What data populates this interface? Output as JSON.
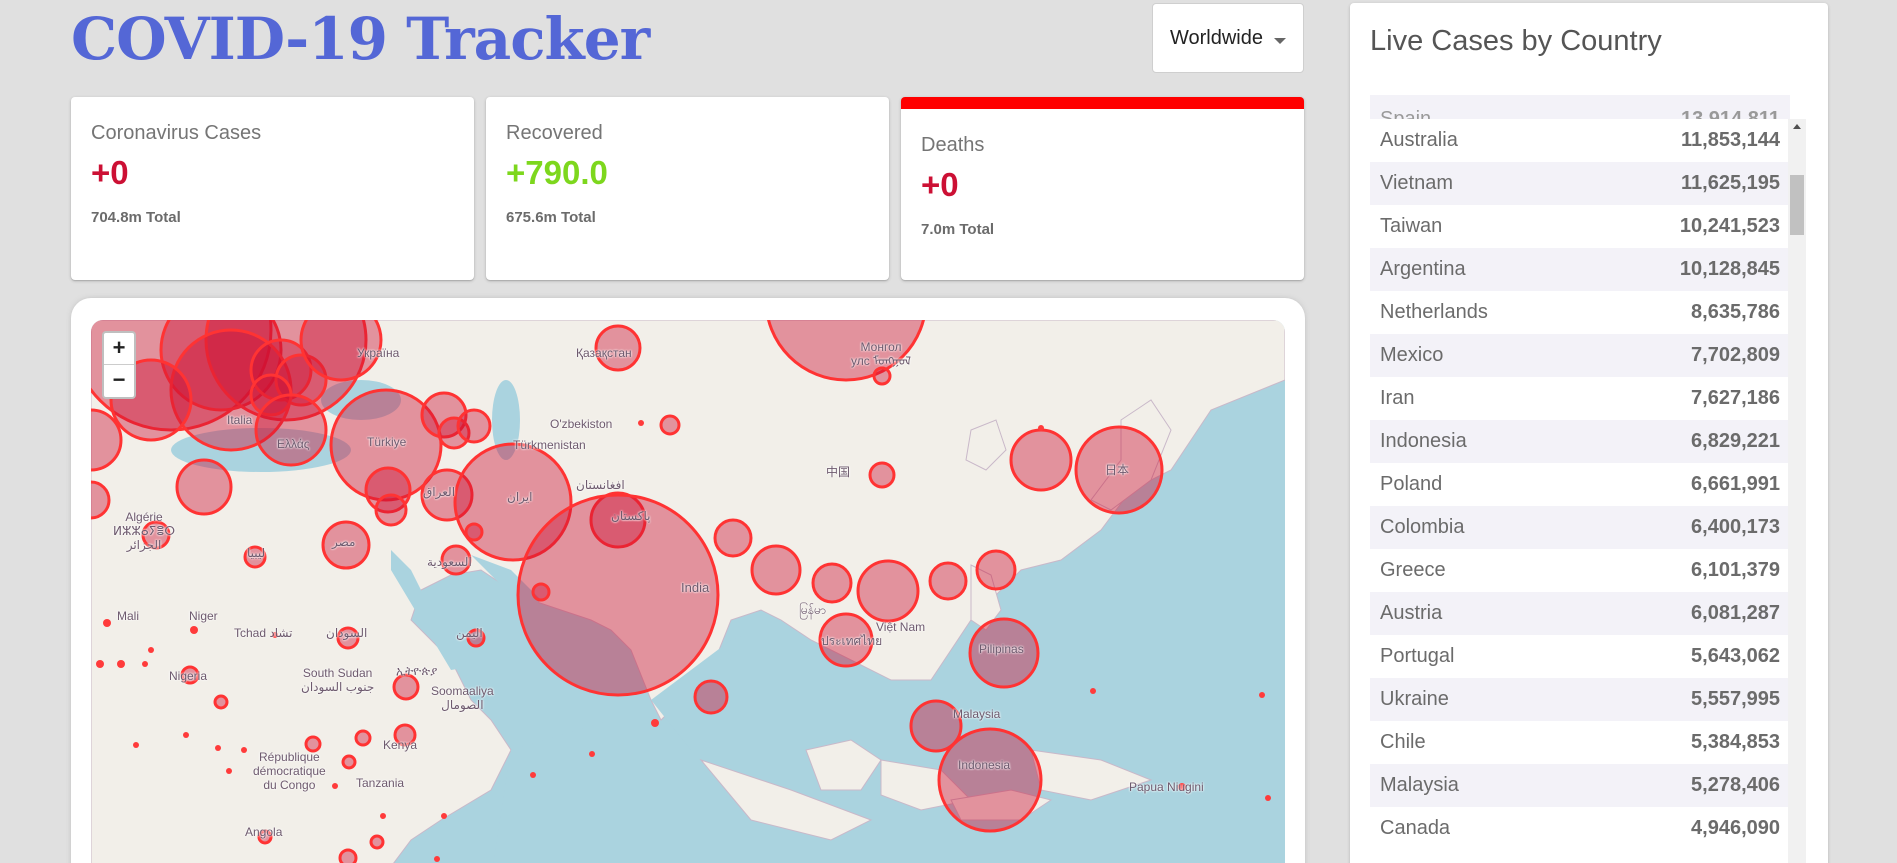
{
  "header": {
    "title": "COVID-19 Tracker",
    "country_select": {
      "value": "Worldwide"
    }
  },
  "stats": [
    {
      "label": "Coronavirus Cases",
      "value": "+0",
      "total": "704.8m Total",
      "active": false
    },
    {
      "label": "Recovered",
      "value": "+790.0",
      "total": "675.6m Total",
      "active": false
    },
    {
      "label": "Deaths",
      "value": "+0",
      "total": "7.0m Total",
      "active": true
    }
  ],
  "map": {
    "zoom_in": "+",
    "zoom_out": "−",
    "labels": {
      "kazakhstan": "Қазақстан",
      "mongolia": "Монгол\nулс ᠮᠣᠩᠭᠣᠯ",
      "ukraine": "Україна",
      "uzbekistan": "O'zbekiston",
      "turkmenistan": "Türkmenistan",
      "turkiye": "Türkiye",
      "italia": "Italia",
      "ellas": "Ελλάς",
      "china": "中国",
      "japan": "日本",
      "iraq": "العراق",
      "iran": "ایران",
      "afghanistan": "افغانستان",
      "pakistan": "پاکستان",
      "algeria": "Algérie\nⵍⵣⵣⴰⵢⴻⵔ\nالجزائر",
      "libya": "ليبيا",
      "egypt": "مصر",
      "saudi": "السعودية",
      "india": "India",
      "myanmar": "မြန်မာ",
      "vietnam": "Việt Nam",
      "thailand": "ประเทศไทย",
      "philippines": "Pilipinas",
      "malaysia": "Malaysia",
      "indonesia": "Indonesia",
      "papua": "Papua Niugini",
      "mali": "Mali",
      "niger": "Niger",
      "chad": "Tchad تشاد",
      "sudan": "السودان",
      "yemen": "اليمن",
      "nigeria": "Nigeria",
      "south_sudan": "South Sudan\nجنوب السودان",
      "ethiopia": "ኢትዮጵያ",
      "somalia": "Soomaaliya\nالصومال",
      "kenya": "Kenya",
      "drc": "République\ndémocratique\ndu Congo",
      "tanzania": "Tanzania",
      "angola": "Angola"
    },
    "circle_color": "#cc1034"
  },
  "live_cases": {
    "title": "Live Cases by Country",
    "clipped_row": {
      "country": "Spain",
      "cases": "13,914,811"
    },
    "rows": [
      {
        "country": "Australia",
        "cases": "11,853,144"
      },
      {
        "country": "Vietnam",
        "cases": "11,625,195"
      },
      {
        "country": "Taiwan",
        "cases": "10,241,523"
      },
      {
        "country": "Argentina",
        "cases": "10,128,845"
      },
      {
        "country": "Netherlands",
        "cases": "8,635,786"
      },
      {
        "country": "Mexico",
        "cases": "7,702,809"
      },
      {
        "country": "Iran",
        "cases": "7,627,186"
      },
      {
        "country": "Indonesia",
        "cases": "6,829,221"
      },
      {
        "country": "Poland",
        "cases": "6,661,991"
      },
      {
        "country": "Colombia",
        "cases": "6,400,173"
      },
      {
        "country": "Greece",
        "cases": "6,101,379"
      },
      {
        "country": "Austria",
        "cases": "6,081,287"
      },
      {
        "country": "Portugal",
        "cases": "5,643,062"
      },
      {
        "country": "Ukraine",
        "cases": "5,557,995"
      },
      {
        "country": "Chile",
        "cases": "5,384,853"
      },
      {
        "country": "Malaysia",
        "cases": "5,278,406"
      },
      {
        "country": "Canada",
        "cases": "4,946,090"
      }
    ]
  }
}
